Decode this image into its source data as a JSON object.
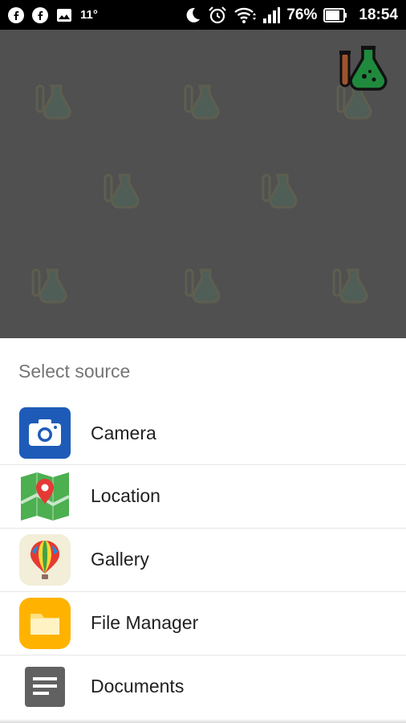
{
  "status_bar": {
    "temperature": "11°",
    "battery": "76%",
    "time": "18:54",
    "icons_left": [
      "facebook-icon",
      "facebook-icon",
      "gallery-notification-icon"
    ],
    "icons_right": [
      "moon-icon",
      "alarm-icon",
      "wifi-icon",
      "signal-icon",
      "battery-icon"
    ]
  },
  "sheet": {
    "title": "Select source",
    "options": [
      {
        "label": "Camera",
        "icon": "camera-icon",
        "color": "#1e5bb8"
      },
      {
        "label": "Location",
        "icon": "map-pin-icon",
        "color": "#4caf50"
      },
      {
        "label": "Gallery",
        "icon": "hot-air-balloon-icon",
        "color": "#f2eed8"
      },
      {
        "label": "File Manager",
        "icon": "folder-icon",
        "color": "#ffb300"
      },
      {
        "label": "Documents",
        "icon": "document-icon",
        "color": "#616161"
      }
    ]
  },
  "colors": {
    "status_bar_bg": "#000000",
    "dim_overlay": "#505050",
    "logo_green": "#1f8a3d",
    "logo_brown": "#a0522d"
  }
}
